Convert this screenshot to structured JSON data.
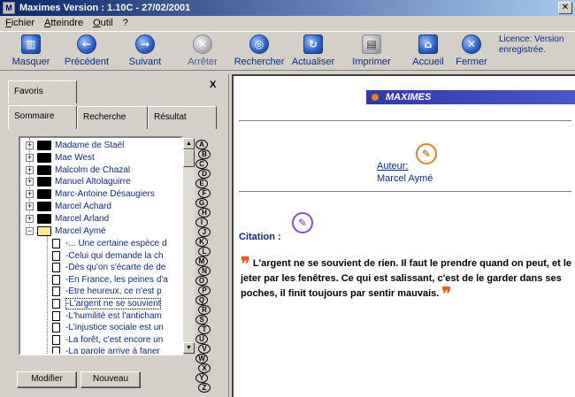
{
  "window": {
    "title": "Maximes Version : 1.10C - 27/02/2001",
    "close_glyph": "✕"
  },
  "menu": [
    "Fichier",
    "Atteindre",
    "Outil",
    "?"
  ],
  "toolbar": {
    "buttons": [
      {
        "label": "Masquer",
        "icon": "hide-icon"
      },
      {
        "label": "Précédent",
        "icon": "back-arrow-icon"
      },
      {
        "label": "Suivant",
        "icon": "forward-arrow-icon"
      },
      {
        "label": "Arrêter",
        "icon": "stop-icon"
      },
      {
        "label": "Rechercher",
        "icon": "search-icon"
      },
      {
        "label": "Actualiser",
        "icon": "refresh-icon"
      },
      {
        "label": "Imprimer",
        "icon": "printer-icon"
      },
      {
        "label": "Accueil",
        "icon": "home-icon"
      },
      {
        "label": "Fermer",
        "icon": "close-icon"
      }
    ],
    "licence_text": "Licence: Version enregistrée."
  },
  "left_panel": {
    "tabs": {
      "favoris": "Favoris",
      "sommaire": "Sommaire",
      "recherche": "Recherche",
      "resultat": "Résultat"
    },
    "close_glyph": "X",
    "authors": [
      "Madame de Staël",
      "Mae West",
      "Malcolm de Chazal",
      "Manuel Altolaguirre",
      "Marc-Antoine Désaugiers",
      "Marcel Achard",
      "Marcel Arland",
      "Marcel Aymé"
    ],
    "quotes": [
      "-... Une certaine espèce d",
      "-Celui qui demande la ch",
      "-Dès qu'on s'écarte de de",
      "-En France, les peines d'a",
      "-Etre heureux, ce n'est p",
      "-L'argent ne se souvient",
      "-L'humilité est l'anticham",
      "-L'injustice sociale est un",
      "-La forêt, c'est encore un",
      "-La parole arrive à faner"
    ],
    "selected_quote_index": 5,
    "alphabet": [
      "A",
      "B",
      "C",
      "D",
      "E",
      "F",
      "G",
      "H",
      "I",
      "J",
      "K",
      "L",
      "M",
      "N",
      "O",
      "P",
      "Q",
      "R",
      "S",
      "T",
      "U",
      "V",
      "W",
      "X",
      "Y",
      "Z"
    ],
    "modifier_label": "Modifier",
    "nouveau_label": "Nouveau"
  },
  "right_pane": {
    "banner": "MAXIMES",
    "auteur_label": "Auteur:",
    "auteur_name": "Marcel Aymé",
    "citation_label": "Citation :",
    "quote": "L'argent ne se souvient de rien. Il faut le prendre quand on peut, et le jeter par les fenêtres. Ce qui est salissant, c'est de le garder dans ses poches, il finit toujours par sentir mauvais.",
    "open_quote_glyph": "❞",
    "close_quote_glyph": "❞"
  }
}
